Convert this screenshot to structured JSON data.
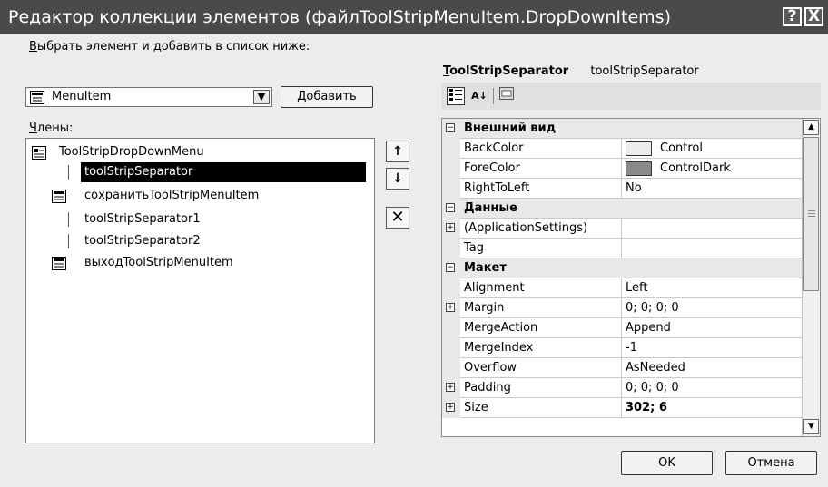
{
  "window": {
    "title": "Редактор коллекции элементов (файлToolStripMenuItem.DropDownItems)",
    "help_glyph": "?",
    "close_glyph": "X"
  },
  "left": {
    "select_label": "Выбрать элемент и добавить в список ниже:",
    "combo_value": "MenuItem",
    "add_button": "Добавить",
    "members_label": "Члены:",
    "tree": [
      {
        "label": "ToolStripDropDownMenu",
        "icon": "menu-icon",
        "selected": false
      },
      {
        "label": "toolStripSeparator",
        "icon": "separator-line",
        "selected": true
      },
      {
        "label": "сохранитьToolStripMenuItem",
        "icon": "menuitem-icon",
        "selected": false
      },
      {
        "label": "toolStripSeparator1",
        "icon": "separator-line",
        "selected": false
      },
      {
        "label": "toolStripSeparator2",
        "icon": "separator-line",
        "selected": false
      },
      {
        "label": "выходToolStripMenuItem",
        "icon": "menuitem-icon",
        "selected": false
      }
    ],
    "up_glyph": "↑",
    "down_glyph": "↓",
    "delete_glyph": "✕"
  },
  "right": {
    "object_type": "ToolStripSeparator",
    "object_name": "toolStripSeparator",
    "toolbar_icons": [
      "categorized-icon",
      "alphabetical-icon",
      "property-pages-icon"
    ],
    "alpha_glyph": "A↓",
    "rows": [
      {
        "type": "category",
        "name": "Внешний вид"
      },
      {
        "type": "prop",
        "name": "BackColor",
        "value": "Control",
        "swatch": "#ececec"
      },
      {
        "type": "prop",
        "name": "ForeColor",
        "value": "ControlDark",
        "swatch": "#8a8a8a"
      },
      {
        "type": "prop",
        "name": "RightToLeft",
        "value": "No"
      },
      {
        "type": "category",
        "name": "Данные"
      },
      {
        "type": "prop",
        "name": "(ApplicationSettings)",
        "value": "",
        "expandable": true
      },
      {
        "type": "prop",
        "name": "Tag",
        "value": ""
      },
      {
        "type": "category",
        "name": "Макет"
      },
      {
        "type": "prop",
        "name": "Alignment",
        "value": "Left"
      },
      {
        "type": "prop",
        "name": "Margin",
        "value": "0; 0; 0; 0",
        "expandable": true
      },
      {
        "type": "prop",
        "name": "MergeAction",
        "value": "Append"
      },
      {
        "type": "prop",
        "name": "MergeIndex",
        "value": "-1"
      },
      {
        "type": "prop",
        "name": "Overflow",
        "value": "AsNeeded"
      },
      {
        "type": "prop",
        "name": "Padding",
        "value": "0; 0; 0; 0",
        "expandable": true
      },
      {
        "type": "prop",
        "name": "Size",
        "value": "302; 6",
        "expandable": true,
        "bold": true
      }
    ]
  },
  "buttons": {
    "ok": "OK",
    "cancel": "Отмена"
  }
}
